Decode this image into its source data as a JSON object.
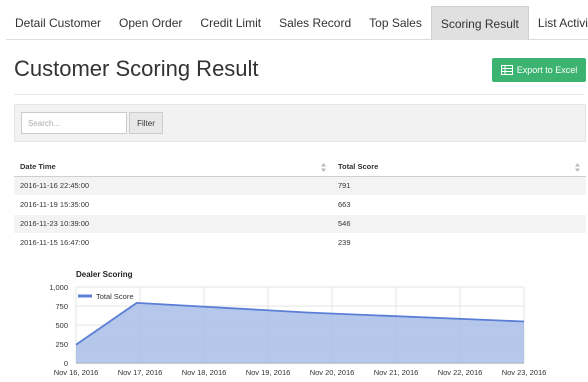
{
  "tabs": [
    {
      "label": "Detail Customer",
      "active": false
    },
    {
      "label": "Open Order",
      "active": false
    },
    {
      "label": "Credit Limit",
      "active": false
    },
    {
      "label": "Sales Record",
      "active": false
    },
    {
      "label": "Top Sales",
      "active": false
    },
    {
      "label": "Scoring Result",
      "active": true
    },
    {
      "label": "List Activity",
      "active": false
    }
  ],
  "page": {
    "title": "Customer Scoring Result",
    "export_label": "Export to Excel"
  },
  "filter": {
    "search_placeholder": "Search...",
    "filter_label": "Filter"
  },
  "table": {
    "columns": [
      "Date Time",
      "Total Score"
    ],
    "rows": [
      [
        "2016-11-16 22:45:00",
        "791"
      ],
      [
        "2016-11-19 15:35:00",
        "663"
      ],
      [
        "2016-11-23 10:39:00",
        "546"
      ],
      [
        "2016-11-15 16:47:00",
        "239"
      ]
    ]
  },
  "colors": {
    "accent": "#3cb371",
    "series_line": "#5b7fd6",
    "series_fill": "#a9bde9"
  },
  "chart_data": {
    "type": "area",
    "title": "Dealer Scoring",
    "xlabel": "",
    "ylabel": "",
    "ylim": [
      0,
      1000
    ],
    "yticks": [
      "0",
      "250",
      "500",
      "750",
      "1,000"
    ],
    "categories": [
      "Nov 16, 2016",
      "Nov 17, 2016",
      "Nov 18, 2016",
      "Nov 19, 2016",
      "Nov 20, 2016",
      "Nov 21, 2016",
      "Nov 22, 2016",
      "Nov 23, 2016"
    ],
    "series": [
      {
        "name": "Total Score",
        "points": [
          {
            "x": "2016-11-15 16:47:00",
            "y": 239
          },
          {
            "x": "2016-11-16 22:45:00",
            "y": 791
          },
          {
            "x": "2016-11-19 15:35:00",
            "y": 663
          },
          {
            "x": "2016-11-23 10:39:00",
            "y": 546
          }
        ]
      }
    ],
    "grid": true,
    "legend": "top-left"
  }
}
